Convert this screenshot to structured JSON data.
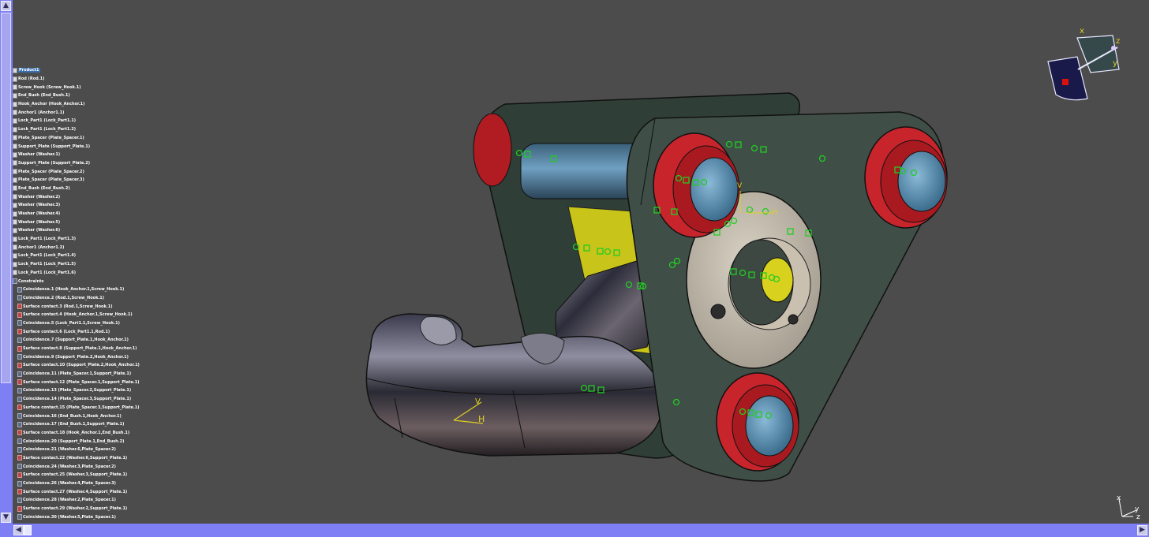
{
  "tree": {
    "root": "Product1",
    "parts": [
      "Rod (Rod.1)",
      "Screw_Hook (Screw_Hook.1)",
      "End_Bush (End_Bush.1)",
      "Hook_Anchor (Hook_Anchor.1)",
      "Anchor1 (Anchor1.1)",
      "Lock_Part1 (Lock_Part1.1)",
      "Lock_Part1 (Lock_Part1.2)",
      "Plate_Spacer (Plate_Spacer.1)",
      "Support_Plate (Support_Plate.1)",
      "Washer (Washer.1)",
      "Support_Plate (Support_Plate.2)",
      "Plate_Spacer (Plate_Spacer.2)",
      "Plate_Spacer (Plate_Spacer.3)",
      "End_Bush (End_Bush.2)",
      "Washer (Washer.2)",
      "Washer (Washer.3)",
      "Washer (Washer.4)",
      "Washer (Washer.5)",
      "Washer (Washer.6)",
      "Lock_Part1 (Lock_Part1.3)",
      "Anchor1 (Anchor1.2)",
      "Lock_Part1 (Lock_Part1.4)",
      "Lock_Part1 (Lock_Part1.5)",
      "Lock_Part1 (Lock_Part1.6)"
    ],
    "constraints_label": "Constraints",
    "constraints": [
      {
        "kind": "con",
        "label": "Coincidence.1 (Hook_Anchor.1,Screw_Hook.1)"
      },
      {
        "kind": "con",
        "label": "Coincidence.2 (Rod.1,Screw_Hook.1)"
      },
      {
        "kind": "surf",
        "label": "Surface contact.3 (Rod.1,Screw_Hook.1)"
      },
      {
        "kind": "surf",
        "label": "Surface contact.4 (Hook_Anchor.1,Screw_Hook.1)"
      },
      {
        "kind": "con",
        "label": "Coincidence.5 (Lock_Part1.1,Screw_Hook.1)"
      },
      {
        "kind": "surf",
        "label": "Surface contact.6 (Lock_Part1.1,Rod.1)"
      },
      {
        "kind": "con",
        "label": "Coincidence.7 (Support_Plate.1,Hook_Anchor.1)"
      },
      {
        "kind": "surf",
        "label": "Surface contact.8 (Support_Plate.1,Hook_Anchor.1)"
      },
      {
        "kind": "con",
        "label": "Coincidence.9 (Support_Plate.2,Hook_Anchor.1)"
      },
      {
        "kind": "surf",
        "label": "Surface contact.10 (Support_Plate.2,Hook_Anchor.1)"
      },
      {
        "kind": "con",
        "label": "Coincidence.11 (Plate_Spacer.1,Support_Plate.1)"
      },
      {
        "kind": "surf",
        "label": "Surface contact.12 (Plate_Spacer.1,Support_Plate.1)"
      },
      {
        "kind": "con",
        "label": "Coincidence.13 (Plate_Spacer.2,Support_Plate.1)"
      },
      {
        "kind": "con",
        "label": "Coincidence.14 (Plate_Spacer.3,Support_Plate.1)"
      },
      {
        "kind": "surf",
        "label": "Surface contact.15 (Plate_Spacer.3,Support_Plate.1)"
      },
      {
        "kind": "con",
        "label": "Coincidence.16 (End_Bush.1,Hook_Anchor.1)"
      },
      {
        "kind": "con",
        "label": "Coincidence.17 (End_Bush.1,Support_Plate.1)"
      },
      {
        "kind": "surf",
        "label": "Surface contact.18 (Hook_Anchor.1,End_Bush.1)"
      },
      {
        "kind": "con",
        "label": "Coincidence.20 (Support_Plate.1,End_Bush.2)"
      },
      {
        "kind": "con",
        "label": "Coincidence.21 (Washer.6,Plate_Spacer.2)"
      },
      {
        "kind": "surf",
        "label": "Surface contact.22 (Washer.6,Support_Plate.1)"
      },
      {
        "kind": "con",
        "label": "Coincidence.24 (Washer.3,Plate_Spacer.2)"
      },
      {
        "kind": "surf",
        "label": "Surface contact.25 (Washer.3,Support_Plate.1)"
      },
      {
        "kind": "con",
        "label": "Coincidence.26 (Washer.4,Plate_Spacer.3)"
      },
      {
        "kind": "surf",
        "label": "Surface contact.27 (Washer.4,Support_Plate.1)"
      },
      {
        "kind": "con",
        "label": "Coincidence.28 (Washer.2,Plate_Spacer.1)"
      },
      {
        "kind": "surf",
        "label": "Surface contact.29 (Washer.2,Support_Plate.1)"
      },
      {
        "kind": "con",
        "label": "Coincidence.30 (Washer.5,Plate_Spacer.1)"
      }
    ]
  },
  "compass": {
    "x_label": "x",
    "y_label": "y",
    "z_label": "z"
  },
  "axis_triad": {
    "x_label": "x",
    "y_label": "y",
    "z_label": "z"
  },
  "model_axis": {
    "v_label": "V",
    "h_label": "H"
  },
  "anchor_axis": {
    "v_label": "V",
    "h_label": "H"
  },
  "colors": {
    "background": "#4c4c4c",
    "scrollbar": "#7e7ef5",
    "plate": "#3f4f47",
    "lock_ring": "#c8242c",
    "bush": "#5d89a8",
    "constraint_marker": "#22cc22"
  }
}
